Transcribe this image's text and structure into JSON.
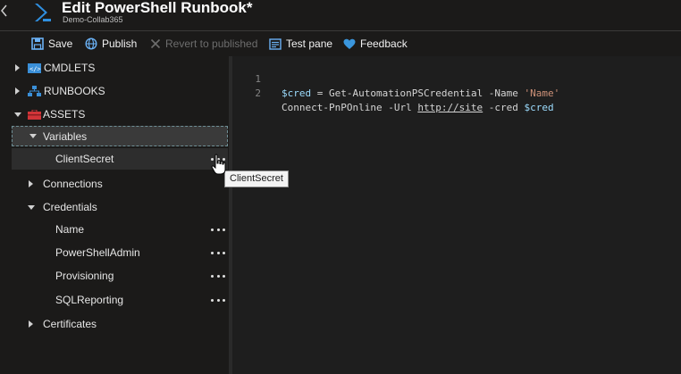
{
  "header": {
    "title": "Edit PowerShell Runbook*",
    "subtitle": "Demo-Collab365"
  },
  "toolbar": {
    "save": "Save",
    "publish": "Publish",
    "revert": "Revert to published",
    "test_pane": "Test pane",
    "feedback": "Feedback"
  },
  "tree": {
    "cmdlets": "CMDLETS",
    "runbooks": "RUNBOOKS",
    "assets": "ASSETS",
    "variables": "Variables",
    "variable_items": [
      "ClientSecret"
    ],
    "connections": "Connections",
    "credentials": "Credentials",
    "credential_items": [
      "Name",
      "PowerShellAdmin",
      "Provisioning",
      "SQLReporting"
    ],
    "certificates": "Certificates"
  },
  "tooltip": "ClientSecret",
  "editor": {
    "line_numbers": [
      "1",
      "2"
    ],
    "line1": {
      "var": "$cred",
      "eq": " = ",
      "cmd": "Get-AutomationPSCredential -Name ",
      "str": "'Name'"
    },
    "line2": {
      "cmd": "Connect-PnPOnline -Url ",
      "url": "http://site",
      "param": " -cred ",
      "var": "$cred"
    }
  },
  "colors": {
    "accent": "#0078d4",
    "string": "#ce9178",
    "variable": "#9cdcfe",
    "feedback_heart": "#3a96dd",
    "revert_x": "#6d6d6d"
  }
}
